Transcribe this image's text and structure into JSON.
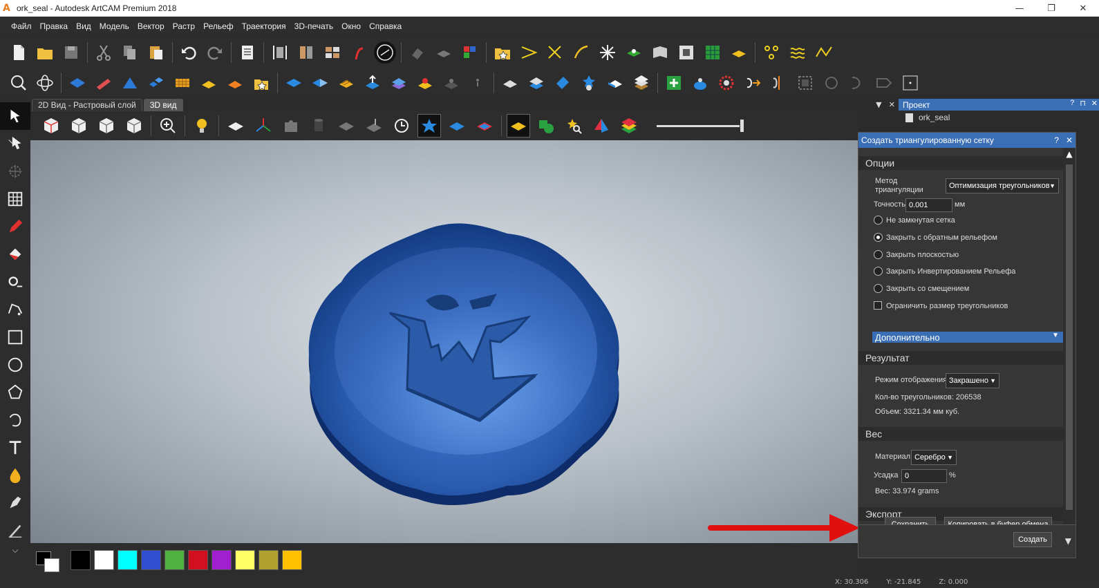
{
  "window": {
    "title": "ork_seal - Autodesk ArtCAM Premium 2018",
    "min_icon": "minimize-icon",
    "max_icon": "restore-icon",
    "close_icon": "close-icon"
  },
  "menu": [
    "Файл",
    "Правка",
    "Вид",
    "Модель",
    "Вектор",
    "Растр",
    "Рельеф",
    "Траектория",
    "3D-печать",
    "Окно",
    "Справка"
  ],
  "tabs": [
    {
      "label": "2D Вид - Растровый слой",
      "active": false
    },
    {
      "label": "3D вид",
      "active": true
    }
  ],
  "project": {
    "title": "Проект",
    "help": "?",
    "close": "✕",
    "root": "ork_seal"
  },
  "dialog": {
    "title": "Создать триангулированную сетку",
    "help": "?",
    "close": "✕",
    "options": {
      "header": "Опции",
      "method_label_1": "Метод",
      "method_label_2": "триангуляции",
      "method_value": "Оптимизация треугольников",
      "precision_label": "Точность",
      "precision_value": "0.001",
      "precision_unit": "мм",
      "radios": [
        {
          "label": "Не замкнутая сетка",
          "checked": false
        },
        {
          "label": "Закрыть с обратным рельефом",
          "checked": true
        },
        {
          "label": "Закрыть плоскостью",
          "checked": false
        },
        {
          "label": "Закрыть Инвертированием Рельефа",
          "checked": false
        },
        {
          "label": "Закрыть со смещением",
          "checked": false
        }
      ],
      "limit_label": "Ограничить размер треугольников",
      "limit_checked": false,
      "advanced_label": "Дополнительно"
    },
    "result": {
      "header": "Результат",
      "display_label": "Режим отображения",
      "display_value": "Закрашено",
      "triangles": "Кол-во треугольников: 206538",
      "volume": "Объем: 3321.34 мм куб."
    },
    "weight": {
      "header": "Вес",
      "material_label": "Материал",
      "material_value": "Серебро",
      "shrink_label": "Усадка",
      "shrink_value": "0",
      "shrink_unit": "%",
      "weight_text": "Вес: 33.974 grams"
    },
    "export": {
      "header": "Экспорт",
      "save_label": "Сохранить",
      "copy_label": "Копировать в буфер обмена"
    },
    "create_label": "Создать"
  },
  "palette": [
    "#000000",
    "#ffffff",
    "#00ffff",
    "#3050d0",
    "#50b040",
    "#d01020",
    "#a020d0",
    "#ffff66",
    "#b0a030",
    "#ffc000"
  ],
  "status": {
    "x": "X: 30.306",
    "y": "Y: -21.845",
    "z": "Z: 0.000"
  },
  "colors": {
    "accent": "#3a6fb5",
    "seal": "#2a5cb0",
    "arrow": "#e01010"
  }
}
